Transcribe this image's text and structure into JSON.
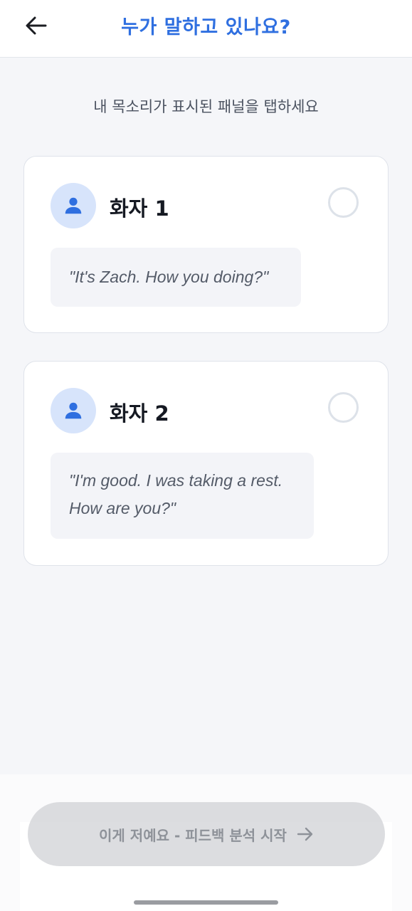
{
  "header": {
    "title": "누가 말하고 있나요?",
    "back_icon": "arrow-left-icon"
  },
  "instruction": "내 목소리가 표시된 패널을 탭하세요",
  "speakers": [
    {
      "name": "화자 1",
      "quote": "\"It's Zach. How you doing?\"",
      "avatar_icon": "person-icon",
      "selected": false
    },
    {
      "name": "화자 2",
      "quote": "\"I'm good. I was taking a rest. How are you?\"",
      "avatar_icon": "person-icon",
      "selected": false
    }
  ],
  "cta": {
    "label": "이게 저예요 - 피드백 분석 시작",
    "icon": "arrow-right-icon",
    "enabled": false
  },
  "colors": {
    "accent": "#2f6fe0",
    "avatar_bg": "#d7e4fb",
    "background": "#f5f6f9",
    "disabled_button": "#d0d1d5"
  }
}
